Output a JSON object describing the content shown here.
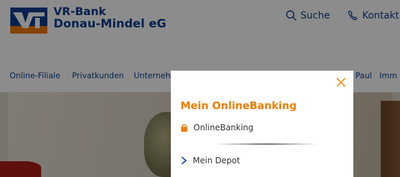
{
  "brand": {
    "line1": "VR-Bank",
    "line2": "Donau-Mindel eG",
    "primary_color": "#0a3d91",
    "accent_color": "#f07d00"
  },
  "header": {
    "search_label": "Suche",
    "search_icon": "search-icon",
    "contact_label": "Kontakt",
    "contact_icon": "phone-icon"
  },
  "nav": {
    "items": [
      "Online-Filiale",
      "Privatkunden",
      "Unternehi",
      "Paul",
      "Imm"
    ]
  },
  "popup": {
    "title": "Mein OnlineBanking",
    "online_banking_label": "OnlineBanking",
    "online_banking_icon": "lock-icon",
    "depot_label": "Mein Depot",
    "depot_icon": "chevron-right-icon",
    "close_icon": "close-icon"
  }
}
